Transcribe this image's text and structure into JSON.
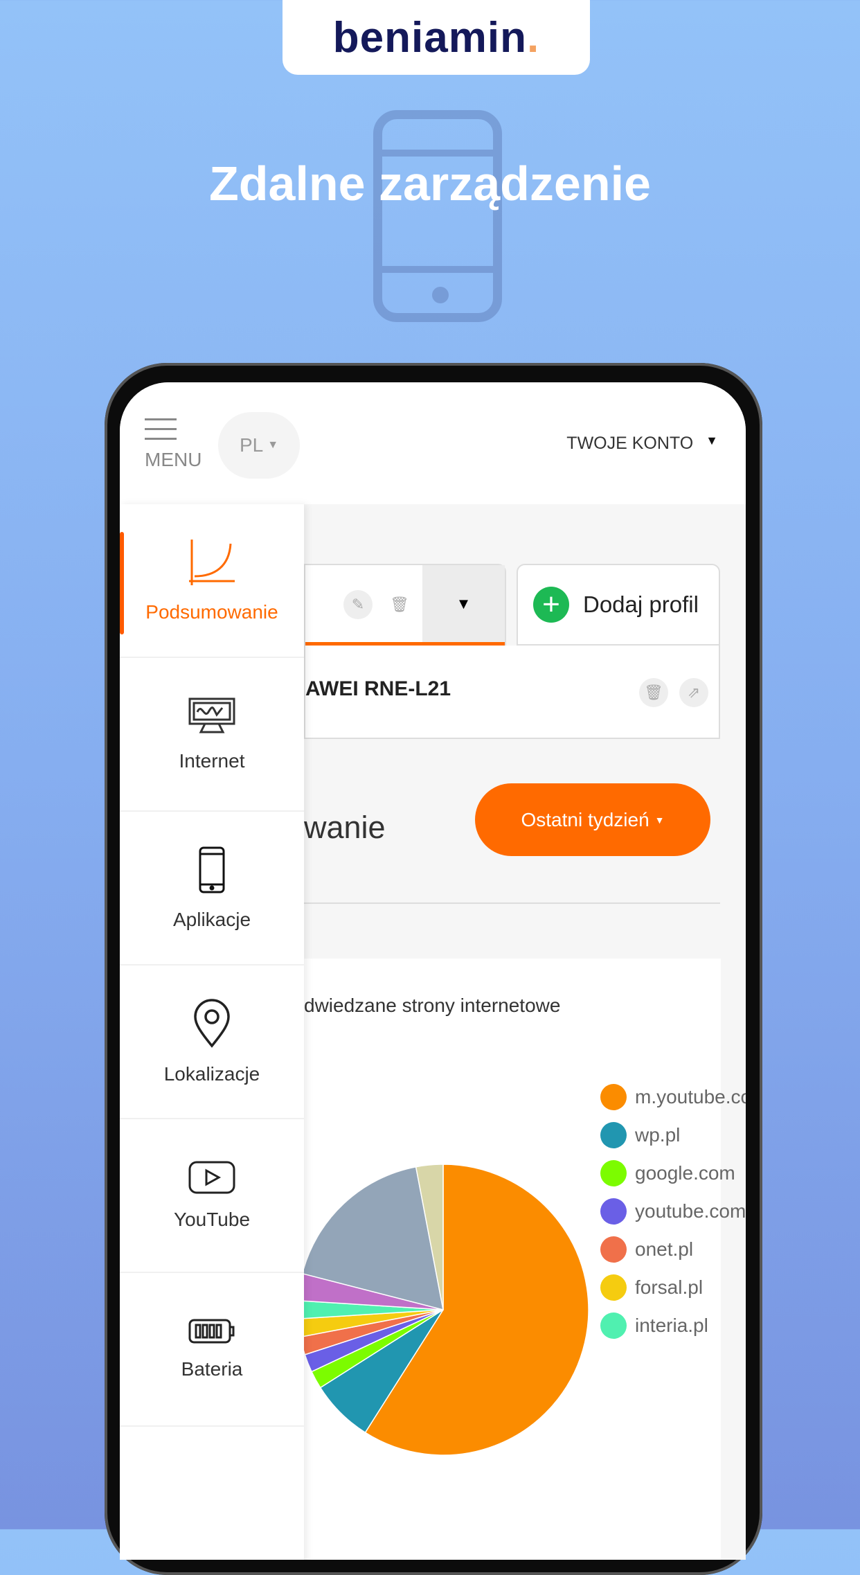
{
  "brand": {
    "logo_text": "beniamin",
    "logo_dot": "."
  },
  "headline": "Zdalne zarządzenie",
  "header": {
    "menu_label": "MENU",
    "language": "PL",
    "account": "TWOJE KONTO"
  },
  "sidebar": {
    "items": [
      {
        "label": "Podsumowanie",
        "icon": "chart-curve-icon",
        "active": true
      },
      {
        "label": "Internet",
        "icon": "monitor-icon"
      },
      {
        "label": "Aplikacje",
        "icon": "smartphone-icon"
      },
      {
        "label": "Lokalizacje",
        "icon": "map-pin-icon"
      },
      {
        "label": "YouTube",
        "icon": "youtube-play-icon"
      },
      {
        "label": "Bateria",
        "icon": "battery-icon"
      }
    ]
  },
  "profile": {
    "add_profile": "Dodaj profil",
    "device_name": "AWEI RNE-L21"
  },
  "main": {
    "title": "wanie",
    "period": "Ostatni tydzień"
  },
  "colors": {
    "accent": "#ff6a00",
    "add": "#1db954"
  },
  "chart_data": {
    "type": "pie",
    "title": "dwiedzane strony internetowe",
    "legend_position": "right",
    "slices": [
      {
        "name": "m.youtube.com",
        "value": 59,
        "color": "#fb8c00"
      },
      {
        "name": "wp.pl",
        "value": 7,
        "color": "#2196b0"
      },
      {
        "name": "google.com",
        "value": 2,
        "color": "#7cfc00"
      },
      {
        "name": "youtube.com",
        "value": 2,
        "color": "#6a5fe6"
      },
      {
        "name": "onet.pl",
        "value": 2,
        "color": "#f0704a"
      },
      {
        "name": "forsal.pl",
        "value": 2,
        "color": "#f5cc10"
      },
      {
        "name": "interia.pl",
        "value": 2,
        "color": "#50f0b0"
      },
      {
        "value": 3,
        "color": "#c070c8"
      },
      {
        "value": 18,
        "color": "#93a5b8"
      },
      {
        "value": 3,
        "color": "#d8d6a8"
      }
    ]
  }
}
